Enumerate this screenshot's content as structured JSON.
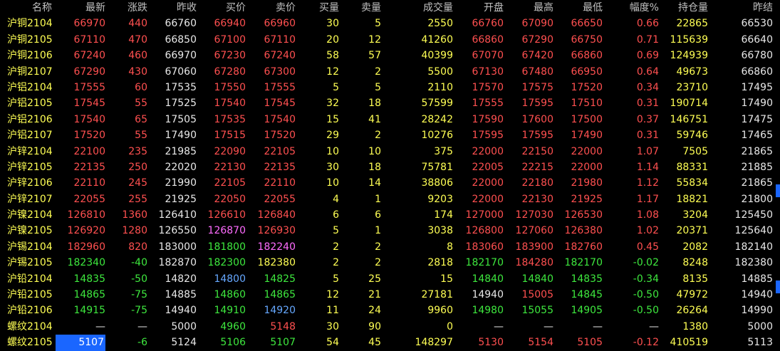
{
  "headers": [
    "名称",
    "最新",
    "涨跌",
    "昨收",
    "买价",
    "卖价",
    "买量",
    "卖量",
    "成交量",
    "开盘",
    "最高",
    "最低",
    "幅度%",
    "持仓量",
    "昨结"
  ],
  "rows": [
    {
      "name": "沪铜2104",
      "values": [
        "66970",
        "440",
        "66760",
        "66940",
        "66960",
        "30",
        "5",
        "2550",
        "66760",
        "67090",
        "66650",
        "0.66",
        "22865",
        "66530"
      ],
      "colors": [
        "r",
        "r",
        "w",
        "r",
        "r",
        "y",
        "y",
        "y",
        "r",
        "r",
        "r",
        "r",
        "y",
        "w"
      ]
    },
    {
      "name": "沪铜2105",
      "values": [
        "67110",
        "470",
        "66850",
        "67100",
        "67110",
        "20",
        "12",
        "41260",
        "66860",
        "67290",
        "66750",
        "0.71",
        "115639",
        "66640"
      ],
      "colors": [
        "r",
        "r",
        "w",
        "r",
        "r",
        "y",
        "y",
        "y",
        "r",
        "r",
        "r",
        "r",
        "y",
        "w"
      ]
    },
    {
      "name": "沪铜2106",
      "values": [
        "67240",
        "460",
        "66970",
        "67230",
        "67240",
        "58",
        "57",
        "40399",
        "67070",
        "67420",
        "66860",
        "0.69",
        "124939",
        "66780"
      ],
      "colors": [
        "r",
        "r",
        "w",
        "r",
        "r",
        "y",
        "y",
        "y",
        "r",
        "r",
        "r",
        "r",
        "y",
        "w"
      ]
    },
    {
      "name": "沪铜2107",
      "values": [
        "67290",
        "430",
        "67060",
        "67280",
        "67300",
        "12",
        "2",
        "5500",
        "67130",
        "67480",
        "66950",
        "0.64",
        "49673",
        "66860"
      ],
      "colors": [
        "r",
        "r",
        "w",
        "r",
        "r",
        "y",
        "y",
        "y",
        "r",
        "r",
        "r",
        "r",
        "y",
        "w"
      ]
    },
    {
      "name": "沪铝2104",
      "values": [
        "17555",
        "60",
        "17535",
        "17550",
        "17555",
        "5",
        "5",
        "2110",
        "17570",
        "17575",
        "17520",
        "0.34",
        "23710",
        "17495"
      ],
      "colors": [
        "r",
        "r",
        "w",
        "r",
        "r",
        "y",
        "y",
        "y",
        "r",
        "r",
        "r",
        "r",
        "y",
        "w"
      ]
    },
    {
      "name": "沪铝2105",
      "values": [
        "17545",
        "55",
        "17525",
        "17540",
        "17545",
        "32",
        "18",
        "57599",
        "17555",
        "17595",
        "17510",
        "0.31",
        "190714",
        "17490"
      ],
      "colors": [
        "r",
        "r",
        "w",
        "r",
        "r",
        "y",
        "y",
        "y",
        "r",
        "r",
        "r",
        "r",
        "y",
        "w"
      ]
    },
    {
      "name": "沪铝2106",
      "values": [
        "17540",
        "65",
        "17505",
        "17535",
        "17540",
        "15",
        "41",
        "28242",
        "17590",
        "17600",
        "17500",
        "0.37",
        "146751",
        "17475"
      ],
      "colors": [
        "r",
        "r",
        "w",
        "r",
        "r",
        "y",
        "y",
        "y",
        "r",
        "r",
        "r",
        "r",
        "y",
        "w"
      ]
    },
    {
      "name": "沪铝2107",
      "values": [
        "17520",
        "55",
        "17490",
        "17515",
        "17520",
        "29",
        "2",
        "10276",
        "17595",
        "17595",
        "17490",
        "0.31",
        "59746",
        "17465"
      ],
      "colors": [
        "r",
        "r",
        "w",
        "r",
        "r",
        "y",
        "y",
        "y",
        "r",
        "r",
        "r",
        "r",
        "y",
        "w"
      ]
    },
    {
      "name": "沪锌2104",
      "values": [
        "22100",
        "235",
        "21985",
        "22090",
        "22105",
        "10",
        "10",
        "375",
        "22000",
        "22150",
        "22000",
        "1.07",
        "7505",
        "21865"
      ],
      "colors": [
        "r",
        "r",
        "w",
        "r",
        "r",
        "y",
        "y",
        "y",
        "r",
        "r",
        "r",
        "r",
        "y",
        "w"
      ]
    },
    {
      "name": "沪锌2105",
      "values": [
        "22135",
        "250",
        "22020",
        "22130",
        "22135",
        "30",
        "18",
        "75781",
        "22005",
        "22215",
        "22000",
        "1.14",
        "88331",
        "21885"
      ],
      "colors": [
        "r",
        "r",
        "w",
        "r",
        "r",
        "y",
        "y",
        "y",
        "r",
        "r",
        "r",
        "r",
        "y",
        "w"
      ]
    },
    {
      "name": "沪锌2106",
      "values": [
        "22110",
        "245",
        "21990",
        "22105",
        "22110",
        "10",
        "14",
        "38806",
        "22000",
        "22180",
        "21980",
        "1.12",
        "55834",
        "21865"
      ],
      "colors": [
        "r",
        "r",
        "w",
        "r",
        "r",
        "y",
        "y",
        "y",
        "r",
        "r",
        "r",
        "r",
        "y",
        "w"
      ]
    },
    {
      "name": "沪锌2107",
      "values": [
        "22055",
        "255",
        "21925",
        "22050",
        "22055",
        "4",
        "1",
        "9203",
        "22000",
        "22130",
        "21925",
        "1.17",
        "18821",
        "21800"
      ],
      "colors": [
        "r",
        "r",
        "w",
        "r",
        "r",
        "y",
        "y",
        "y",
        "r",
        "r",
        "r",
        "r",
        "y",
        "w"
      ]
    },
    {
      "name": "沪镍2104",
      "values": [
        "126810",
        "1360",
        "126410",
        "126610",
        "126840",
        "6",
        "6",
        "174",
        "127000",
        "127030",
        "126530",
        "1.08",
        "3204",
        "125450"
      ],
      "colors": [
        "r",
        "r",
        "w",
        "r",
        "r",
        "y",
        "y",
        "y",
        "r",
        "r",
        "r",
        "r",
        "y",
        "w"
      ]
    },
    {
      "name": "沪镍2105",
      "values": [
        "126920",
        "1280",
        "126550",
        "126870",
        "126930",
        "5",
        "1",
        "3038",
        "126800",
        "127060",
        "126380",
        "1.02",
        "20371",
        "125640"
      ],
      "colors": [
        "r",
        "r",
        "w",
        "m",
        "r",
        "y",
        "y",
        "y",
        "r",
        "r",
        "r",
        "r",
        "y",
        "w"
      ]
    },
    {
      "name": "沪锡2104",
      "values": [
        "182960",
        "820",
        "183000",
        "181800",
        "182240",
        "2",
        "2",
        "8",
        "183060",
        "183900",
        "182760",
        "0.45",
        "2082",
        "182140"
      ],
      "colors": [
        "r",
        "r",
        "w",
        "g",
        "m",
        "y",
        "y",
        "y",
        "r",
        "r",
        "r",
        "r",
        "y",
        "w"
      ]
    },
    {
      "name": "沪锡2105",
      "values": [
        "182340",
        "-40",
        "182870",
        "182300",
        "182380",
        "2",
        "2",
        "2818",
        "182170",
        "184280",
        "182170",
        "-0.02",
        "8248",
        "182380"
      ],
      "colors": [
        "g",
        "g",
        "w",
        "g",
        "y",
        "y",
        "y",
        "y",
        "g",
        "r",
        "g",
        "g",
        "y",
        "w"
      ]
    },
    {
      "name": "沪铅2104",
      "values": [
        "14835",
        "-50",
        "14820",
        "14800",
        "14825",
        "5",
        "25",
        "15",
        "14840",
        "14840",
        "14835",
        "-0.34",
        "8135",
        "14885"
      ],
      "colors": [
        "g",
        "g",
        "w",
        "b",
        "g",
        "y",
        "y",
        "y",
        "g",
        "g",
        "g",
        "g",
        "y",
        "w"
      ]
    },
    {
      "name": "沪铅2105",
      "values": [
        "14865",
        "-75",
        "14885",
        "14860",
        "14865",
        "12",
        "21",
        "27181",
        "14940",
        "15005",
        "14845",
        "-0.50",
        "47972",
        "14940"
      ],
      "colors": [
        "g",
        "g",
        "w",
        "g",
        "g",
        "y",
        "y",
        "y",
        "w",
        "r",
        "g",
        "g",
        "y",
        "w"
      ]
    },
    {
      "name": "沪铅2106",
      "values": [
        "14915",
        "-75",
        "14940",
        "14910",
        "14920",
        "11",
        "24",
        "9960",
        "14980",
        "15055",
        "14905",
        "-0.50",
        "26264",
        "14990"
      ],
      "colors": [
        "g",
        "g",
        "w",
        "g",
        "b",
        "y",
        "y",
        "y",
        "g",
        "g",
        "g",
        "g",
        "y",
        "w"
      ]
    },
    {
      "name": "螺纹2104",
      "values": [
        "—",
        "—",
        "5000",
        "4960",
        "5148",
        "30",
        "90",
        "0",
        "—",
        "—",
        "—",
        "—",
        "1380",
        "5000"
      ],
      "colors": [
        "w",
        "w",
        "w",
        "g",
        "r",
        "y",
        "y",
        "y",
        "w",
        "w",
        "w",
        "w",
        "y",
        "w"
      ]
    },
    {
      "name": "螺纹2105",
      "values": [
        "5107",
        "-6",
        "5124",
        "5106",
        "5107",
        "54",
        "45",
        "148297",
        "5130",
        "5154",
        "5105",
        "-0.12",
        "410519",
        "5113"
      ],
      "colors": [
        "hl",
        "g",
        "w",
        "g",
        "g",
        "y",
        "y",
        "y",
        "r",
        "r",
        "r",
        "r",
        "y",
        "w"
      ]
    }
  ]
}
